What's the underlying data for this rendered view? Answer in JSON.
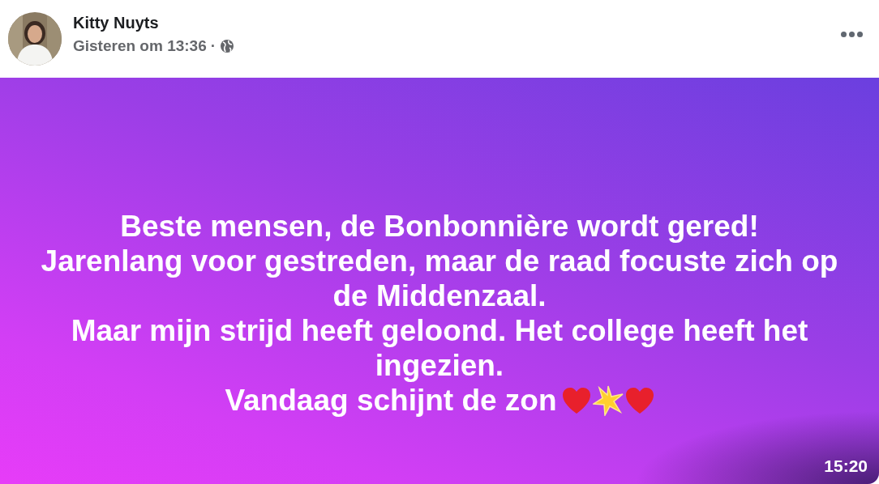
{
  "post": {
    "author": "Kitty Nuyts",
    "time": "Gisteren om 13:36",
    "separator": "·"
  },
  "status": {
    "lines": [
      "Beste mensen, de Bonbonnière wordt gered!",
      "Jarenlang voor gestreden, maar de raad focuste zich op de Middenzaal.",
      "Maar mijn strijd heeft geloond. Het college heeft het ingezien.",
      "Vandaag schijnt de zon"
    ],
    "emoji": [
      {
        "kind": "heart"
      },
      {
        "kind": "star"
      },
      {
        "kind": "heart"
      }
    ]
  },
  "overlay_time": "15:20"
}
